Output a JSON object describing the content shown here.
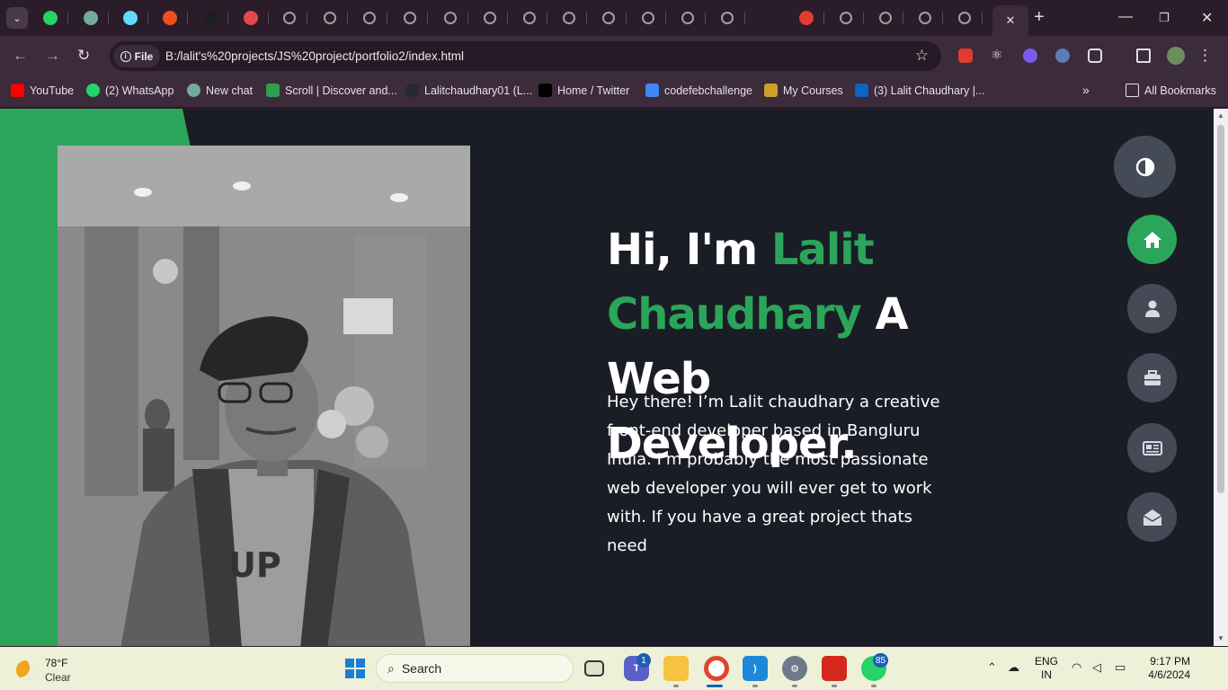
{
  "browser": {
    "url_scheme_chip": "File",
    "url": "B:/lalit's%20projects/JS%20project/portfolio2/index.html",
    "tabs": [
      {
        "icon": "whatsapp-icon",
        "color": "#25d366"
      },
      {
        "icon": "chatgpt-icon",
        "color": "#74aa9c"
      },
      {
        "icon": "react-icon",
        "color": "#61dafb"
      },
      {
        "icon": "figma-icon",
        "color": "#f24e1e"
      },
      {
        "icon": "github-icon",
        "color": "#1b1f23"
      },
      {
        "icon": "arrow-icon",
        "color": "#e5484d"
      },
      {
        "icon": "globe-icon",
        "color": "#a79aa5"
      },
      {
        "icon": "globe-icon",
        "color": "#a79aa5"
      },
      {
        "icon": "globe-icon",
        "color": "#a79aa5"
      },
      {
        "icon": "globe-icon",
        "color": "#a79aa5"
      },
      {
        "icon": "globe-icon",
        "color": "#a79aa5"
      },
      {
        "icon": "globe-icon",
        "color": "#a79aa5"
      },
      {
        "icon": "globe-icon",
        "color": "#a79aa5"
      },
      {
        "icon": "globe-icon",
        "color": "#a79aa5"
      },
      {
        "icon": "globe-icon",
        "color": "#a79aa5"
      },
      {
        "icon": "globe-icon",
        "color": "#a79aa5"
      },
      {
        "icon": "globe-icon",
        "color": "#a79aa5"
      },
      {
        "icon": "globe-icon",
        "color": "#a79aa5"
      },
      {
        "icon": "adobe-icon",
        "color": "#e03c31"
      },
      {
        "icon": "globe-icon",
        "color": "#a79aa5"
      },
      {
        "icon": "globe-icon",
        "color": "#a79aa5"
      },
      {
        "icon": "globe-icon",
        "color": "#a79aa5"
      },
      {
        "icon": "globe-icon",
        "color": "#a79aa5"
      },
      {
        "icon": "close-icon",
        "color": "#e6dbe4",
        "active": true
      }
    ],
    "bookmarks": [
      {
        "label": "YouTube",
        "icon": "youtube-icon",
        "color": "#ff0000"
      },
      {
        "label": "(2) WhatsApp",
        "icon": "whatsapp-icon",
        "color": "#25d366"
      },
      {
        "label": "New chat",
        "icon": "chatgpt-icon",
        "color": "#74aa9c"
      },
      {
        "label": "Scroll | Discover and...",
        "icon": "scroll-icon",
        "color": "#2e9e4f"
      },
      {
        "label": "Lalitchaudhary01 (L...",
        "icon": "github-icon",
        "color": "#24292e"
      },
      {
        "label": "Home / Twitter",
        "icon": "x-icon",
        "color": "#000000"
      },
      {
        "label": "codefebchallenge",
        "icon": "docs-icon",
        "color": "#4285f4"
      },
      {
        "label": "My Courses",
        "icon": "courses-icon",
        "color": "#c9a227"
      },
      {
        "label": "(3) Lalit Chaudhary |...",
        "icon": "linkedin-icon",
        "color": "#0a66c2"
      }
    ],
    "all_bookmarks": "All Bookmarks"
  },
  "hero": {
    "greeting": "Hi, I'm ",
    "name_line1": "Lalit",
    "name_line2": "Chaudhary",
    "after_name": " A",
    "line3": "Web",
    "line4": "Developer.",
    "intro": "Hey there! I’m Lalit chaudhary a creative front-end developer based in Bangluru India. I'm probably the most passionate web developer you will ever get to work with. If you have a great project thats need",
    "accent_color": "#2aa55a"
  },
  "nav": [
    {
      "icon": "theme-toggle-icon"
    },
    {
      "icon": "home-icon",
      "active": true
    },
    {
      "icon": "user-icon"
    },
    {
      "icon": "briefcase-icon"
    },
    {
      "icon": "news-icon"
    },
    {
      "icon": "envelope-open-icon"
    }
  ],
  "taskbar": {
    "temperature": "78°F",
    "condition": "Clear",
    "search_placeholder": "Search",
    "teams_badge": "1",
    "whatsapp_badge": "85",
    "lang_line1": "ENG",
    "lang_line2": "IN",
    "time": "9:17 PM",
    "date": "4/6/2024"
  }
}
